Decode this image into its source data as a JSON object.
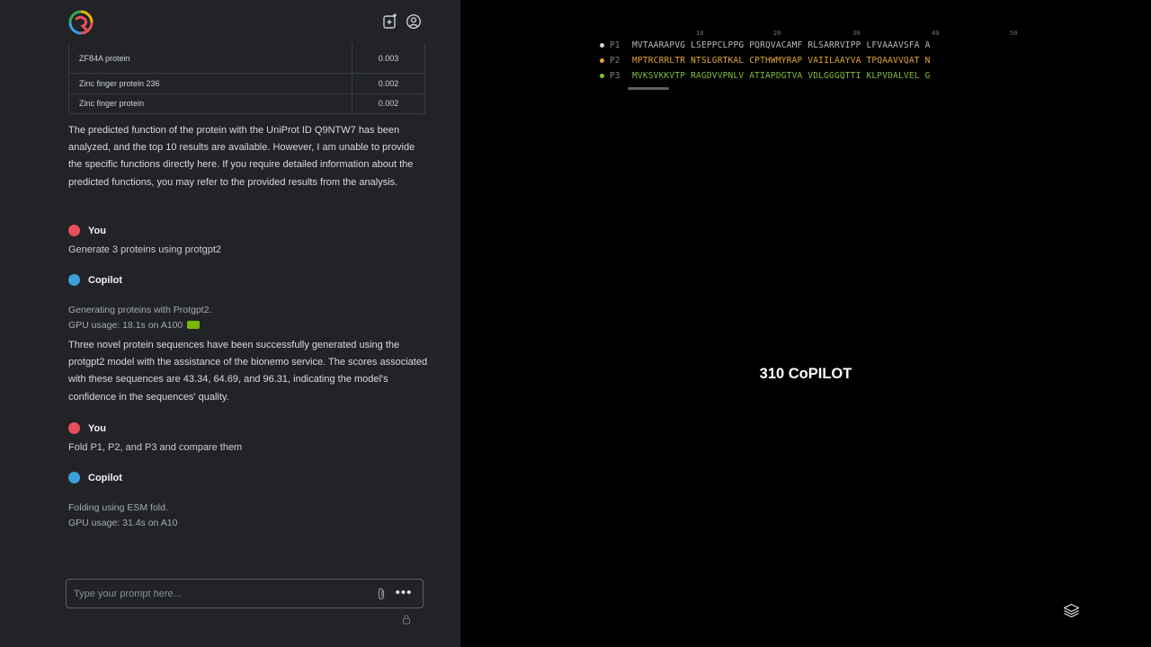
{
  "header": {
    "logo": "copilot-logo",
    "new_chat_icon": "new-chat-icon",
    "account_icon": "account-icon"
  },
  "results_table": {
    "rows": [
      {
        "name": "ZF84A protein",
        "score": "0.003"
      },
      {
        "name": "Zinc finger protein 236",
        "score": "0.002"
      },
      {
        "name": "Zinc finger protein",
        "score": "0.002"
      }
    ]
  },
  "messages": {
    "analysis_summary": "The predicted function of the protein with the UniProt ID Q9NTW7 has been analyzed, and the top 10 results are available. However, I am unable to provide the specific functions directly here. If you require detailed information about the predicted functions, you may refer to the provided results from the analysis.",
    "user_label": "You",
    "copilot_label": "Copilot",
    "user_msg_1": "Generate 3 proteins using protgpt2",
    "status_1_line1": "Generating proteins with Protgpt2.",
    "status_1_line2": "GPU usage: 18.1s on A100",
    "copilot_reply_1": "Three novel protein sequences have been successfully generated using the protgpt2 model with the assistance of the bionemo service. The scores associated with these sequences are 43.34, 64.69, and 96.31, indicating the model's confidence in the sequences' quality.",
    "user_msg_2": "Fold P1, P2, and P3 and compare them",
    "status_2_line1": "Folding using ESM fold.",
    "status_2_line2": "GPU usage: 31.4s on A10"
  },
  "composer": {
    "placeholder": "Type your prompt here...",
    "attach_icon": "paperclip-icon",
    "more_label": "•••"
  },
  "viewer": {
    "ruler": [
      "10",
      "20",
      "30",
      "40",
      "50"
    ],
    "sequences": [
      {
        "label": "P1",
        "sequence": "MVTAARAPVG LSEPPCLPPG PQRQVACAMF RLSARRVIPP LFVAAAVSFA A",
        "color": "#b8bcc2"
      },
      {
        "label": "P2",
        "sequence": "MPTRCRRLTR NTSLGRTKAL CPTHWMYRAP VAIILAAYVA TPQAAVVQAT N",
        "color": "#e0a43a"
      },
      {
        "label": "P3",
        "sequence": "MVKSVKKVTP RAGDVVPNLV ATIAPDGTVA VDLGGGQTTI KLPVDALVEL G",
        "color": "#7fbf3f"
      }
    ],
    "title": "310 CoPILOT",
    "layers_icon": "layers-icon"
  },
  "colors": {
    "user_dot": "#e8505b",
    "copilot_dot": "#3aa0db",
    "gpu_badge": "#76b900"
  }
}
